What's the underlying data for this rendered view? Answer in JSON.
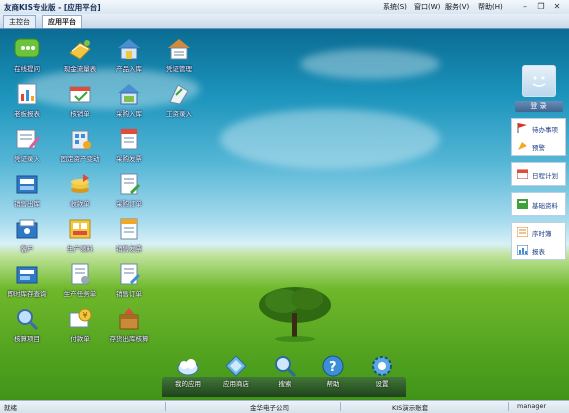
{
  "window": {
    "title": "友商KIS专业版 - [应用平台]"
  },
  "menubar": [
    {
      "label": "系统(S)"
    },
    {
      "label": "窗口(W)"
    },
    {
      "label": "服务(V)"
    },
    {
      "label": "帮助(H)"
    }
  ],
  "tabs": [
    {
      "label": "主控台"
    },
    {
      "label": "应用平台"
    }
  ],
  "desktop_icons": [
    {
      "label": "在线提问",
      "icon": "chat-bubbles-icon"
    },
    {
      "label": "现金流量表",
      "icon": "cash-flow-icon"
    },
    {
      "label": "产品入库",
      "icon": "product-stock-in-icon"
    },
    {
      "label": "凭证管理",
      "icon": "voucher-management-icon"
    },
    {
      "label": "老板报表",
      "icon": "boss-report-icon"
    },
    {
      "label": "核销单",
      "icon": "write-off-icon"
    },
    {
      "label": "采购入库",
      "icon": "purchase-stock-in-icon"
    },
    {
      "label": "工资录入",
      "icon": "salary-entry-icon"
    },
    {
      "label": "凭证录入",
      "icon": "voucher-entry-icon"
    },
    {
      "label": "固定资产变动",
      "icon": "fixed-asset-icon"
    },
    {
      "label": "采购发票",
      "icon": "purchase-invoice-icon"
    },
    {
      "label": "销售出库",
      "icon": "sales-stock-out-icon"
    },
    {
      "label": "收款单",
      "icon": "receipt-icon"
    },
    {
      "label": "采购订单",
      "icon": "purchase-order-icon"
    },
    {
      "label": "客户",
      "icon": "customer-icon"
    },
    {
      "label": "生产领料",
      "icon": "production-material-icon"
    },
    {
      "label": "销售发票",
      "icon": "sales-invoice-icon"
    },
    {
      "label": "即时库存查询",
      "icon": "inventory-query-icon"
    },
    {
      "label": "生产任务单",
      "icon": "production-task-icon"
    },
    {
      "label": "销售订单",
      "icon": "sales-order-icon"
    },
    {
      "label": "核算项目",
      "icon": "accounting-item-icon"
    },
    {
      "label": "付款单",
      "icon": "payment-icon"
    },
    {
      "label": "存货出库核算",
      "icon": "inventory-accounting-icon"
    }
  ],
  "right_panel": {
    "login_label": "登 录",
    "groups": [
      [
        {
          "label": "待办事项",
          "icon": "flag-icon"
        },
        {
          "label": "预警",
          "icon": "alert-icon"
        }
      ],
      [
        {
          "label": "日程计划",
          "icon": "calendar-icon"
        }
      ],
      [
        {
          "label": "基础资料",
          "icon": "book-icon"
        }
      ],
      [
        {
          "label": "序时簿",
          "icon": "ledger-icon"
        },
        {
          "label": "报表",
          "icon": "report-icon"
        }
      ]
    ]
  },
  "taskbar": [
    {
      "label": "我的应用",
      "icon": "my-apps-icon"
    },
    {
      "label": "应用商店",
      "icon": "app-store-icon"
    },
    {
      "label": "搜索",
      "icon": "search-icon"
    },
    {
      "label": "帮助",
      "icon": "help-icon"
    },
    {
      "label": "设置",
      "icon": "settings-icon"
    }
  ],
  "statusbar": {
    "status": "就绪",
    "company": "金华电子公司",
    "account": "KIS演示账套",
    "user": "manager"
  },
  "colors": {
    "accent": "#1d3e86",
    "sky_top": "#0b6c93",
    "grass": "#3f9418"
  }
}
